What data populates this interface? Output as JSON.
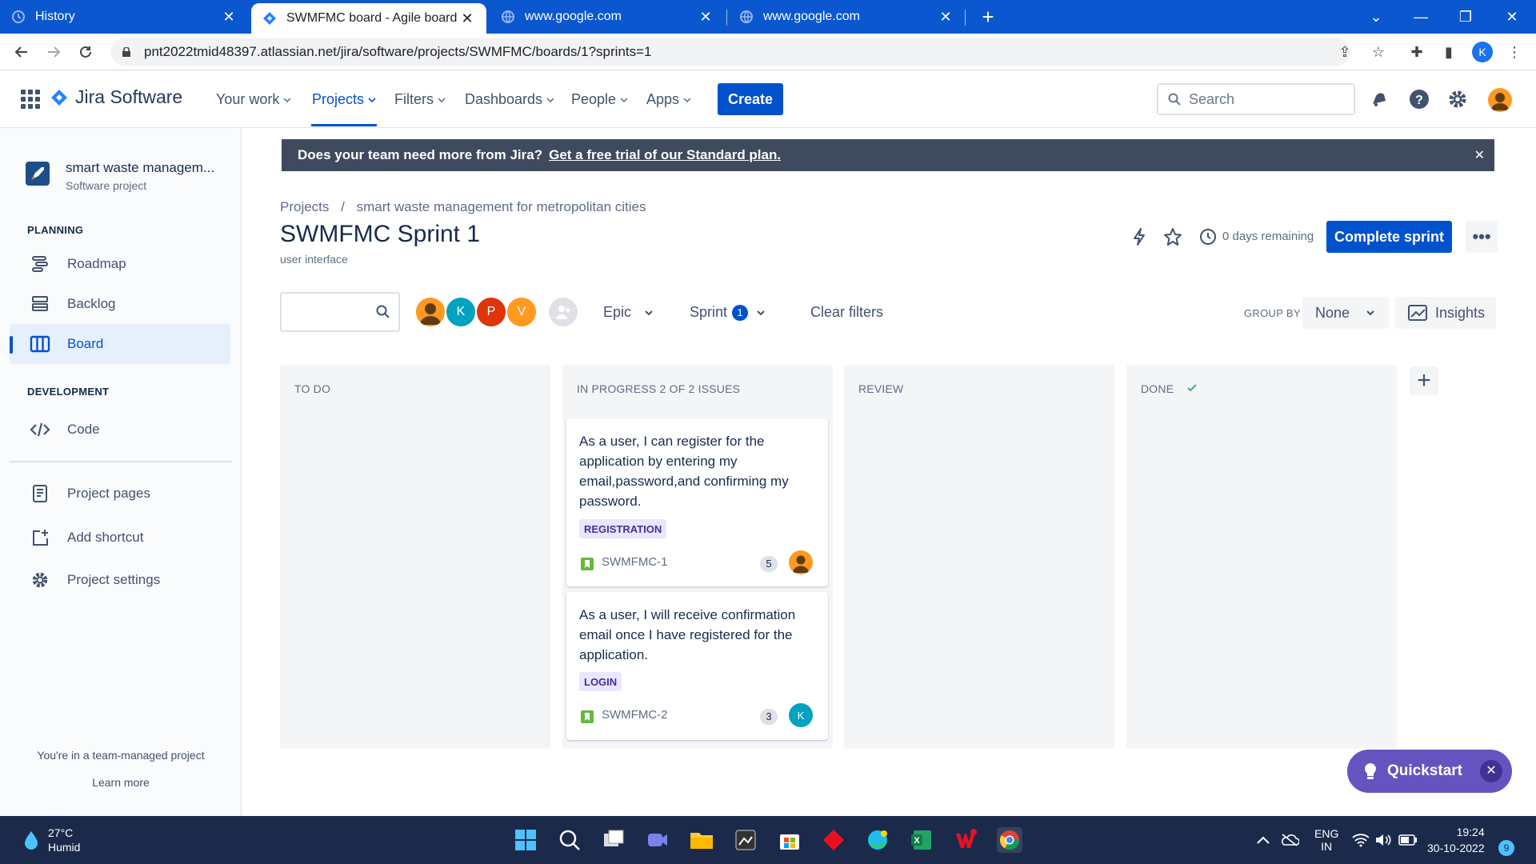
{
  "browser": {
    "tabs": [
      {
        "title": "History"
      },
      {
        "title": "SWMFMC board - Agile board - J"
      },
      {
        "title": "www.google.com"
      },
      {
        "title": "www.google.com"
      }
    ],
    "url": "pnt2022tmid48397.atlassian.net/jira/software/projects/SWMFMC/boards/1?sprints=1",
    "profile_initial": "K"
  },
  "jira_nav": {
    "product": "Jira Software",
    "items": [
      "Your work",
      "Projects",
      "Filters",
      "Dashboards",
      "People",
      "Apps"
    ],
    "create_label": "Create",
    "search_placeholder": "Search"
  },
  "sidebar": {
    "project_name": "smart waste managem...",
    "project_type": "Software project",
    "planning_heading": "PLANNING",
    "planning_items": [
      "Roadmap",
      "Backlog",
      "Board"
    ],
    "development_heading": "DEVELOPMENT",
    "development_items": [
      "Code"
    ],
    "extra_items": [
      "Project pages",
      "Add shortcut",
      "Project settings"
    ],
    "footer_text": "You're in a team-managed project",
    "learn_more": "Learn more"
  },
  "banner": {
    "text": "Does your team need more from Jira?",
    "link": "Get a free trial of our Standard plan."
  },
  "breadcrumb": {
    "root": "Projects",
    "separator": "/",
    "project": "smart waste management for metropolitan cities"
  },
  "sprint": {
    "title": "SWMFMC Sprint 1",
    "subtitle": "user interface",
    "days_remaining": "0 days remaining",
    "complete_label": "Complete sprint"
  },
  "filters": {
    "avatars": [
      "K",
      "P",
      "V"
    ],
    "epic_label": "Epic",
    "sprint_label": "Sprint",
    "sprint_count": "1",
    "clear_label": "Clear filters",
    "group_by_label": "GROUP BY",
    "group_by_value": "None",
    "insights_label": "Insights"
  },
  "columns": [
    {
      "title": "TO DO"
    },
    {
      "title": "IN PROGRESS 2 OF 2 ISSUES"
    },
    {
      "title": "REVIEW"
    },
    {
      "title": "DONE"
    }
  ],
  "cards": [
    {
      "text": "As a user, I can register for the application by entering my email,password,and confirming my password.",
      "label": "REGISTRATION",
      "key": "SWMFMC-1",
      "estimate": "5"
    },
    {
      "text": "As a user, I will receive confirmation email once I have registered for the application.",
      "label": "LOGIN",
      "key": "SWMFMC-2",
      "estimate": "3",
      "assignee": "K"
    }
  ],
  "quickstart_label": "Quickstart",
  "taskbar": {
    "temp": "27°C",
    "condition": "Humid",
    "lang": "ENG",
    "region": "IN",
    "time": "19:24",
    "date": "30-10-2022",
    "notifications": "9"
  },
  "colors": {
    "brand_blue": "#0052cc",
    "chrome_blue": "#0b57d0",
    "quickstart_purple": "#6554c0",
    "taskbar": "#1b2a4a"
  }
}
